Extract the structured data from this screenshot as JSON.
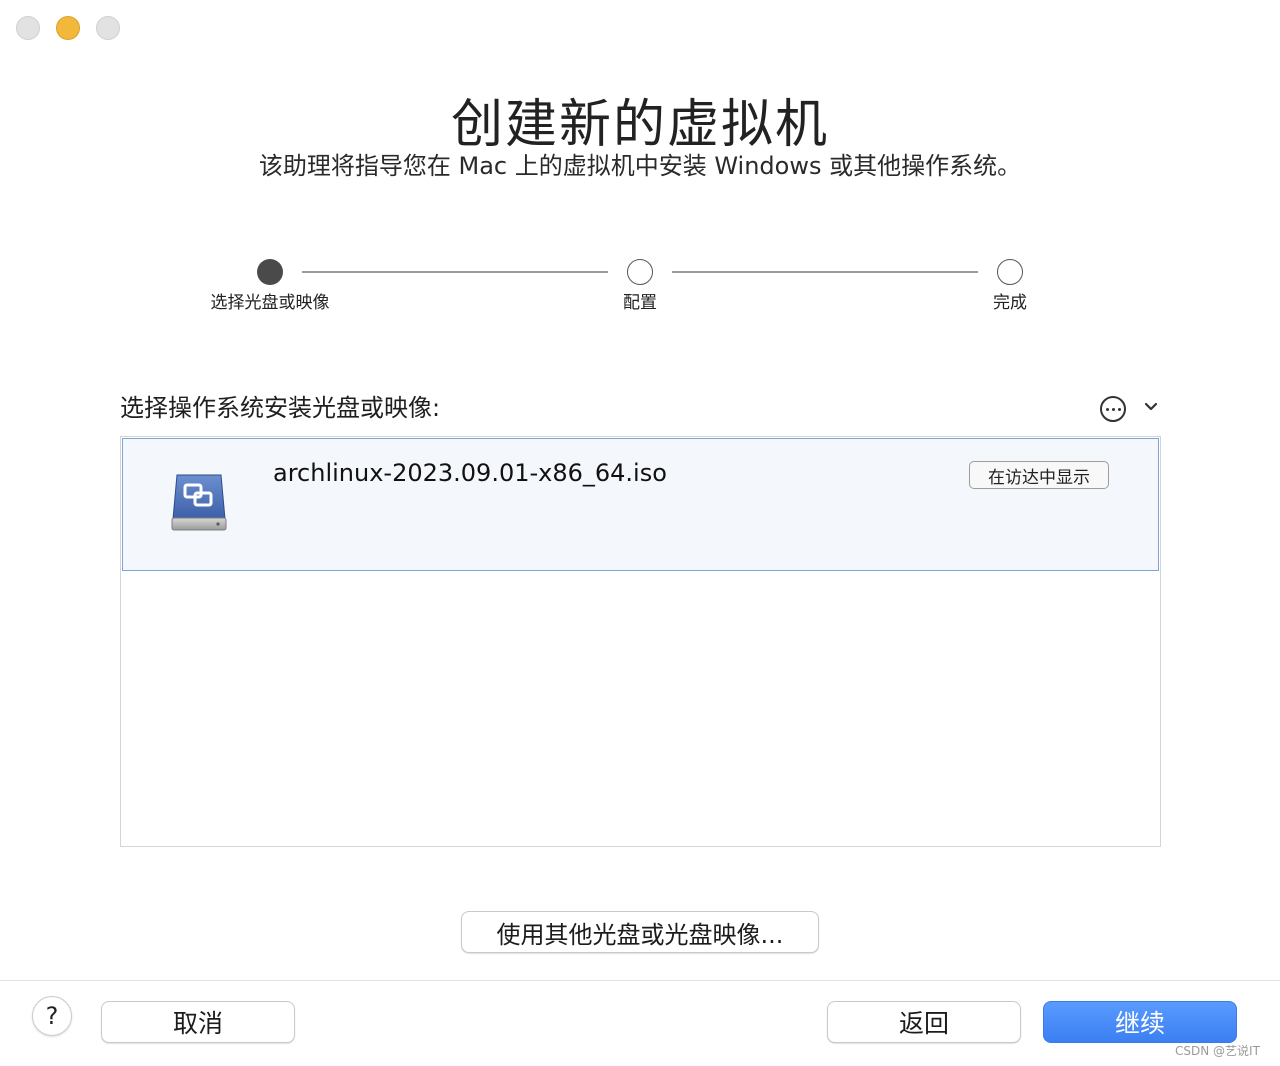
{
  "window": {
    "title": "创建新的虚拟机",
    "subtitle": "该助理将指导您在 Mac 上的虚拟机中安装 Windows 或其他操作系统。"
  },
  "stepper": {
    "steps": [
      {
        "label": "选择光盘或映像",
        "state": "active"
      },
      {
        "label": "配置",
        "state": "pending"
      },
      {
        "label": "完成",
        "state": "pending"
      }
    ]
  },
  "source_list": {
    "label": "选择操作系统安装光盘或映像:",
    "items": [
      {
        "file_name": "archlinux-2023.09.01-x86_64.iso",
        "show_in_finder": "在访达中显示",
        "icon": "disk-image-icon"
      }
    ]
  },
  "other_disc_button": "使用其他光盘或光盘映像...",
  "footer": {
    "help": "?",
    "cancel": "取消",
    "back": "返回",
    "continue": "继续"
  },
  "watermark": "CSDN @艺说IT",
  "colors": {
    "accent": "#3b7ff2",
    "selection_border": "#7ea4d8",
    "selection_bg": "#f4f7fc",
    "traffic_minimize": "#f1b83a"
  }
}
